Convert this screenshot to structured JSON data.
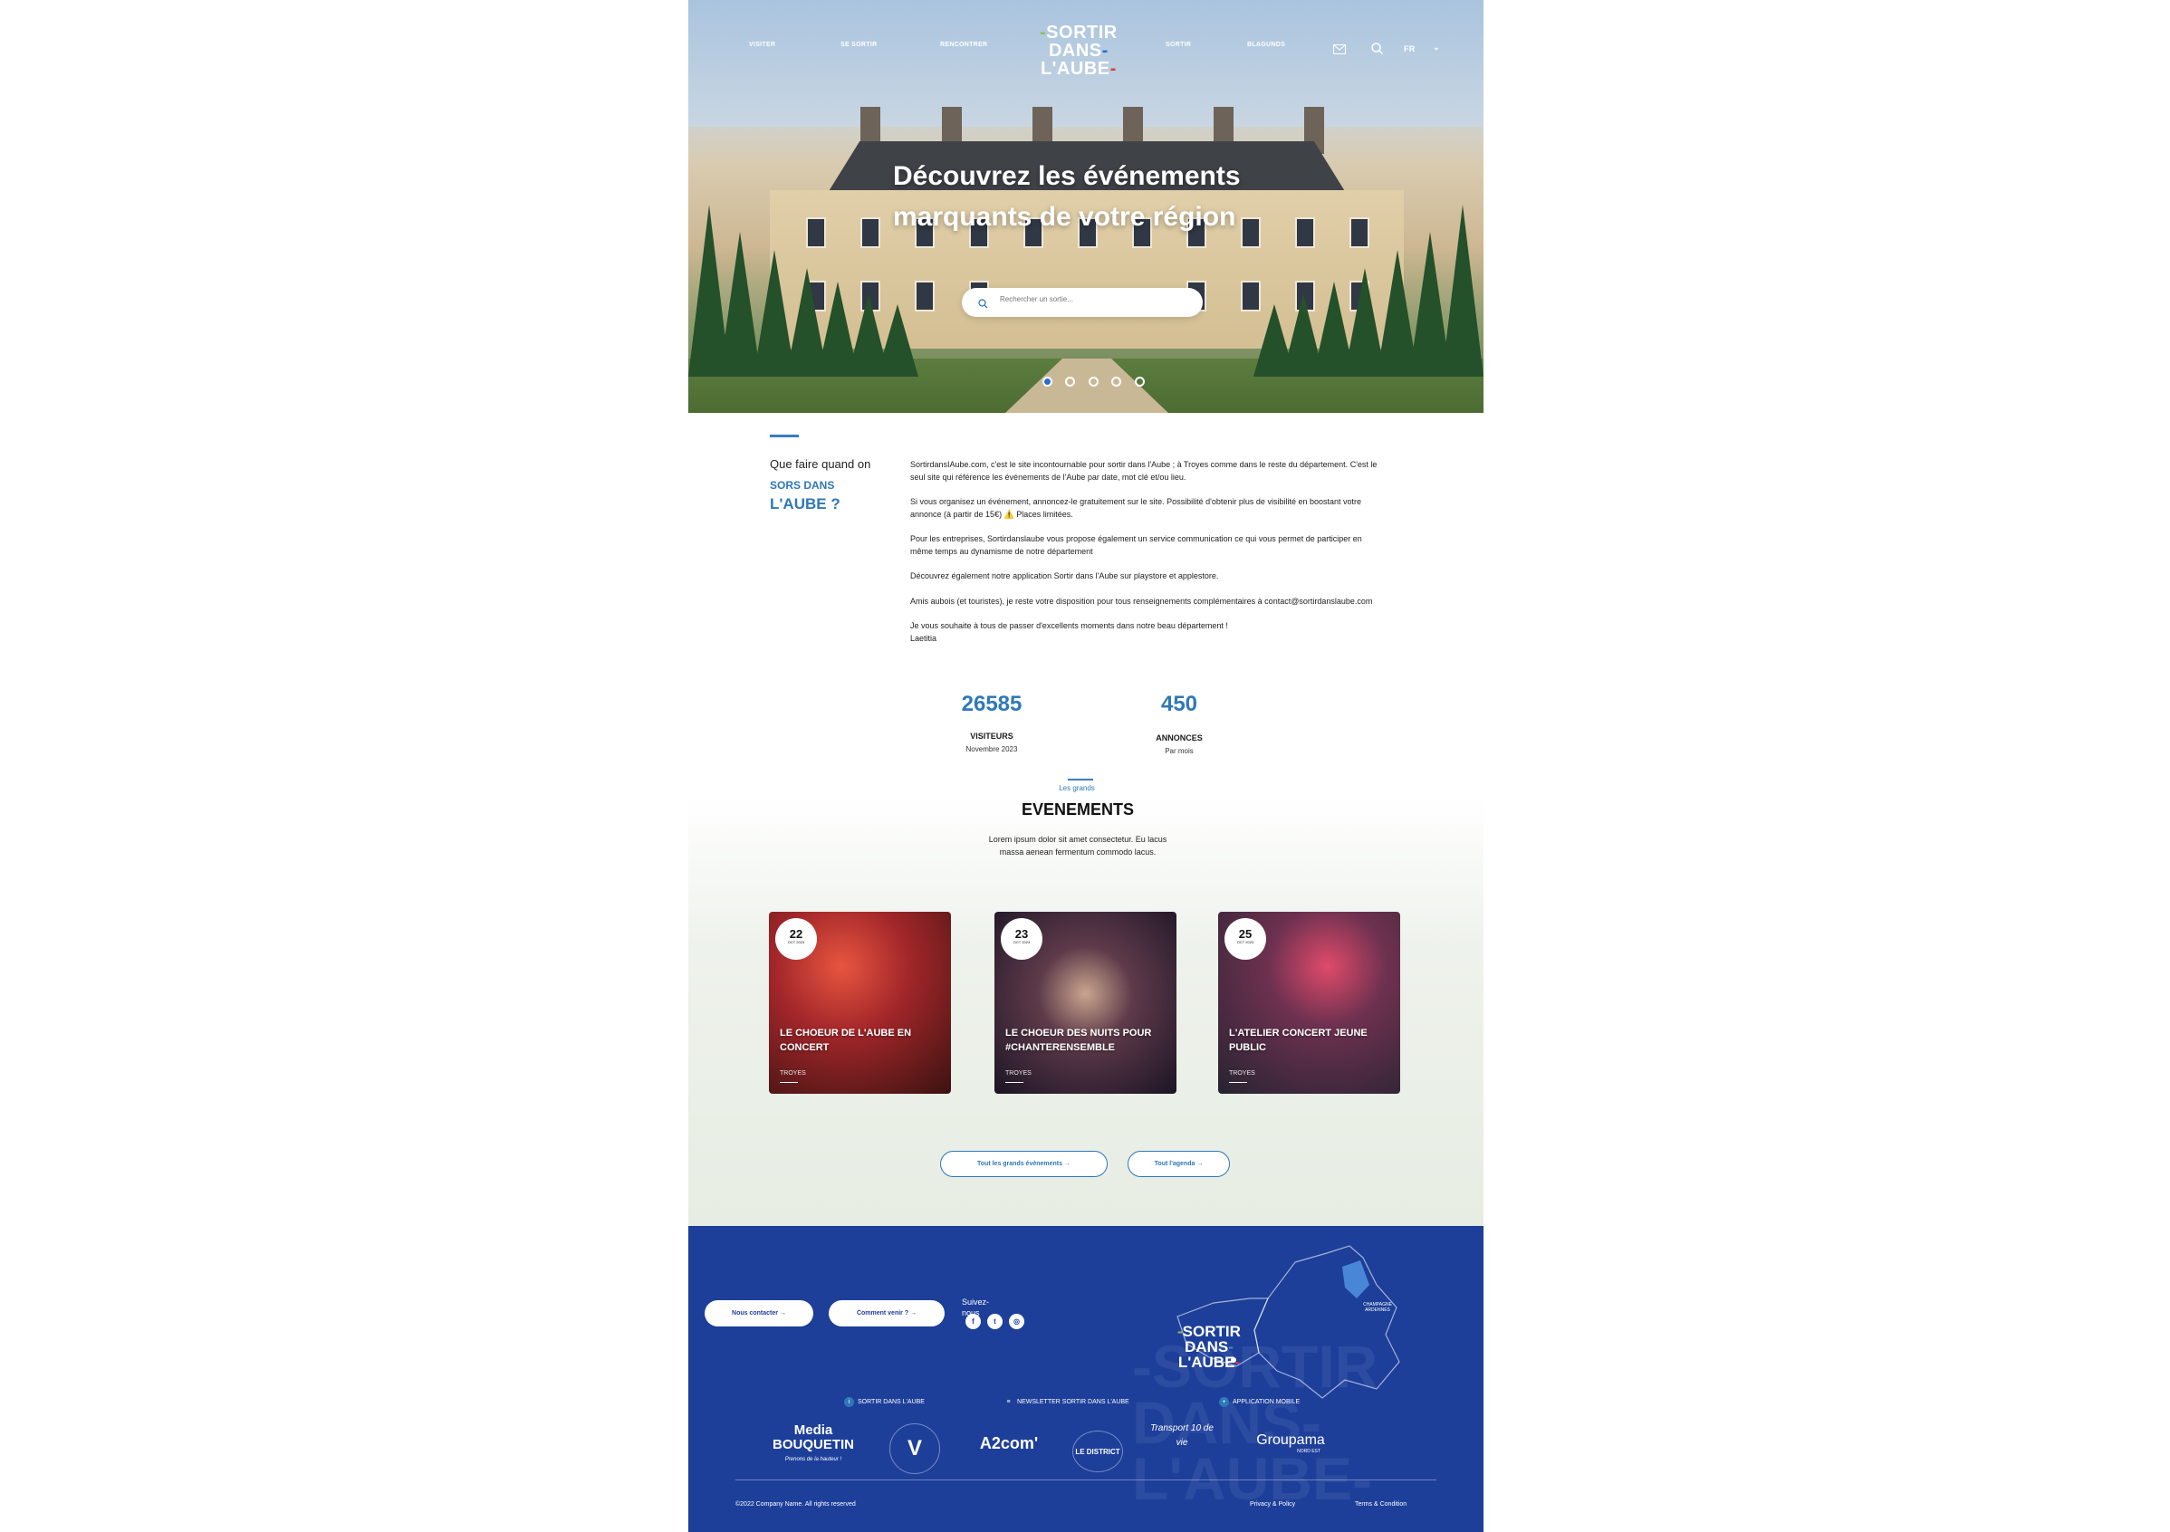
{
  "nav": {
    "left": [
      "VISITER",
      "SE SORTIR",
      "RENCONTRER"
    ],
    "right": [
      "SORTIR",
      "BLAGUNDS"
    ],
    "lang": "FR"
  },
  "logo": {
    "line1": "SORTIR",
    "line2": "DANS",
    "line3": "L'AUBE"
  },
  "hero": {
    "title": "Découvrez les événements marquants de votre région",
    "search_placeholder": "Rechercher un sortie..."
  },
  "intro": {
    "line1": "Que faire quand on",
    "line2": "SORS DANS",
    "line3": "L'AUBE ?",
    "p1": "SortirdansIAube.com, c'est le site incontournable pour sortir dans l'Aube ; à Troyes comme dans le reste du département. C'est le seul site qui référence les événements de l'Aube par date, mot clé et/ou lieu.",
    "p2": "Si vous organisez un événement, annoncez-le gratuitement sur le site. Possibilité d'obtenir plus de visibilité en boostant votre annonce (à partir de 15€) ⚠️ Places limitées.",
    "p3": "Pour les entreprises, Sortirdanslaube vous propose également un service communication ce qui vous permet de participer en même temps au dynamisme de notre département",
    "p4": "Découvrez également notre application Sortir dans l'Aube sur playstore et applestore.",
    "p5": "Amis aubois (et touristes), je reste votre disposition pour tous renseignements complémentaires à contact@sortirdanslaube.com",
    "p6": "Je vous souhaite à tous de passer d'excellents moments dans notre beau département !",
    "sign": "Laetitia"
  },
  "stats": [
    {
      "value": "26585",
      "label": "VISITEURS",
      "sub": "Novembre 2023"
    },
    {
      "value": "450",
      "label": "ANNONCES",
      "sub": "Par mois"
    }
  ],
  "events": {
    "kicker": "Les grands",
    "title": "EVENEMENTS",
    "desc": "Lorem ipsum dolor sit amet consectetur. Eu lacus massa aenean fermentum commodo lacus.",
    "cards": [
      {
        "day": "22",
        "month": "OCT 2023",
        "title": "LE CHOEUR DE L'AUBE EN CONCERT",
        "location": "TROYES"
      },
      {
        "day": "23",
        "month": "OCT 2023",
        "title": "LE CHOEUR DES NUITS pour #CHANTERENSEMBLE",
        "location": "TROYES"
      },
      {
        "day": "25",
        "month": "OCT 2023",
        "title": "L'ATELIER CONCERT JEUNE PUBLIC",
        "location": "TROYES"
      }
    ],
    "btn_all": "Tout les grands évènements →",
    "btn_agenda": "Tout l'agenda →"
  },
  "footer": {
    "btn_contact": "Nous contacter →",
    "btn_come": "Comment venir ? →",
    "follow": "Suivez-nous",
    "social": [
      "f",
      "t",
      "ig"
    ],
    "map_label": "CHAMPAGNE ARDENNES",
    "links": [
      "SORTIR DANS L'AUBE",
      "NEWSLETTER SORTIR DANS L'AUBE",
      "APPLICATION MOBILE"
    ],
    "partners": [
      "Media BOUQUETIN",
      "V",
      "A2com'",
      "LE DISTRICT",
      "Transport 10 de vie",
      "Groupama"
    ],
    "partner_sub": "Prenons de la hauteur !",
    "groupama_sub": "NORD EST",
    "copyright": "©2022 Company Name. All rights reserved",
    "privacy": "Privacy & Policy",
    "terms": "Terms & Condition"
  },
  "colors": {
    "accent": "#2e78b8",
    "footer": "#1d3f9a"
  }
}
